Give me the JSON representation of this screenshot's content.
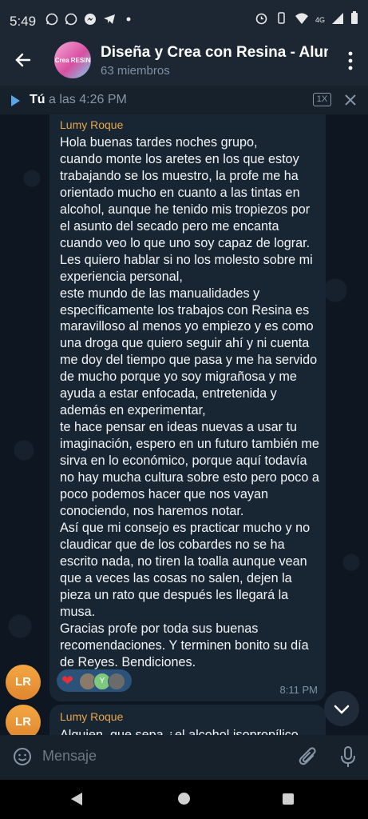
{
  "status_bar": {
    "time": "5:49",
    "network": "4G"
  },
  "header": {
    "title": "Diseña y Crea con Resina - Alumnas",
    "subtitle": "63 miembros",
    "avatar_text": "Crea\nRESIN"
  },
  "audio_bar": {
    "sender": "Tú",
    "time_text": " a las 4:26 PM",
    "speed": "1X"
  },
  "messages": [
    {
      "sender": "Lumy Roque",
      "avatar_initials": "LR",
      "text": "Hola buenas tardes noches grupo,\ncuando monte los aretes en los que estoy trabajando se los muestro, la profe me ha orientado mucho en cuanto a las tintas en alcohol, aunque he tenido mis tropiezos por el asunto del secado pero me encanta cuando veo lo que uno soy capaz de lograr.\nLes quiero hablar si no los molesto sobre mi experiencia personal,\neste mundo de las manualidades y específicamente los trabajos con Resina es maravilloso al menos yo empiezo y es como una droga que quiero seguir ahí y ni cuenta me doy del tiempo que pasa y me ha servido de mucho porque yo soy migrañosa y me ayuda a estar enfocada, entretenida y además en experimentar,\nte hace pensar en ideas nuevas a usar tu imaginación, espero en un futuro también me sirva en lo económico, porque aquí todavía no hay mucha cultura sobre esto pero poco a poco podemos hacer que nos vayan conociendo, nos haremos notar.\nAsí que mi consejo es practicar mucho y no claudicar que de los cobardes no se ha escrito nada, no tiren la toalla aunque vean que a veces las cosas no salen, dejen la pieza un rato que después les llegará la musa.\nGracias profe por toda sus buenas recomendaciones. Y terminen bonito su día de Reyes. Bendiciones.",
      "reaction_emoji": "❤",
      "reaction_avatar_letter": "Y",
      "time": "8:11 PM"
    },
    {
      "sender": "Lumy Roque",
      "avatar_initials": "LR",
      "text": "Alguien, que sepa ¿el alcohol isopropílico"
    }
  ],
  "input": {
    "placeholder": "Mensaje"
  },
  "colors": {
    "accent": "#5aa5e6",
    "sender_name": "#e8a64a",
    "avatar_orange": "#f0a040",
    "bubble": "#182533"
  }
}
